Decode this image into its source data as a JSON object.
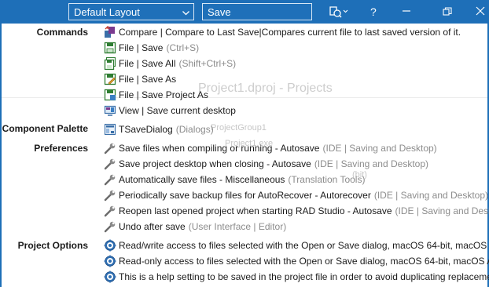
{
  "titlebar": {
    "layout_value": "Default Layout",
    "search_value": "Save"
  },
  "background": {
    "project_title": "Project1.dproj - Projects",
    "group": "ProjectGroup1",
    "item": "Project1.exe",
    "subitem": "(bit)"
  },
  "categories": {
    "commands": "Commands",
    "component_palette": "Component Palette",
    "preferences": "Preferences",
    "project_options": "Project Options"
  },
  "commands": [
    {
      "text": "Compare | Compare to Last Save|Compares current file to last saved version of it.",
      "hint": "",
      "icon": "compare-icon"
    },
    {
      "text": "File | Save",
      "hint": "(Ctrl+S)",
      "icon": "save-icon"
    },
    {
      "text": "File | Save All",
      "hint": "(Shift+Ctrl+S)",
      "icon": "save-all-icon"
    },
    {
      "text": "File | Save As",
      "hint": "",
      "icon": "save-as-icon"
    },
    {
      "text": "File | Save Project As",
      "hint": "",
      "icon": "save-project-as-icon"
    },
    {
      "text": "View | Save current desktop",
      "hint": "",
      "icon": "desktop-icon"
    }
  ],
  "component_palette": [
    {
      "text": "TSaveDialog",
      "hint": "(Dialogs)",
      "icon": "component-icon"
    }
  ],
  "preferences": [
    {
      "text": "Save files when compiling or running - Autosave",
      "hint": "(IDE | Saving and Desktop)",
      "icon": "wrench-icon"
    },
    {
      "text": "Save project desktop when closing - Autosave",
      "hint": "(IDE | Saving and Desktop)",
      "icon": "wrench-icon"
    },
    {
      "text": "Automatically save files - Miscellaneous",
      "hint": "(Translation Tools)",
      "icon": "wrench-icon"
    },
    {
      "text": "Periodically save backup files for AutoRecover - Autorecover",
      "hint": "(IDE | Saving and Desktop)",
      "icon": "wrench-icon"
    },
    {
      "text": "Reopen last opened project when starting RAD Studio - Autosave",
      "hint": "(IDE | Saving and Deskto",
      "icon": "wrench-icon"
    },
    {
      "text": "Undo after save",
      "hint": "(User Interface | Editor)",
      "icon": "wrench-icon"
    }
  ],
  "project_options": [
    {
      "text": "Read/write access to files selected with the Open or Save dialog, macOS 64-bit, macOS AR",
      "hint": "",
      "icon": "gear-icon"
    },
    {
      "text": "Read-only access to files selected with the Open or Save dialog, macOS 64-bit, macOS AR",
      "hint": "",
      "icon": "gear-icon"
    },
    {
      "text": "This is a help setting to be saved in the project file in order to avoid duplicating replaceme",
      "hint": "",
      "icon": "gear-icon"
    }
  ],
  "colors": {
    "titlebar": "#1e6fb8",
    "hint": "#8c8c8c"
  }
}
